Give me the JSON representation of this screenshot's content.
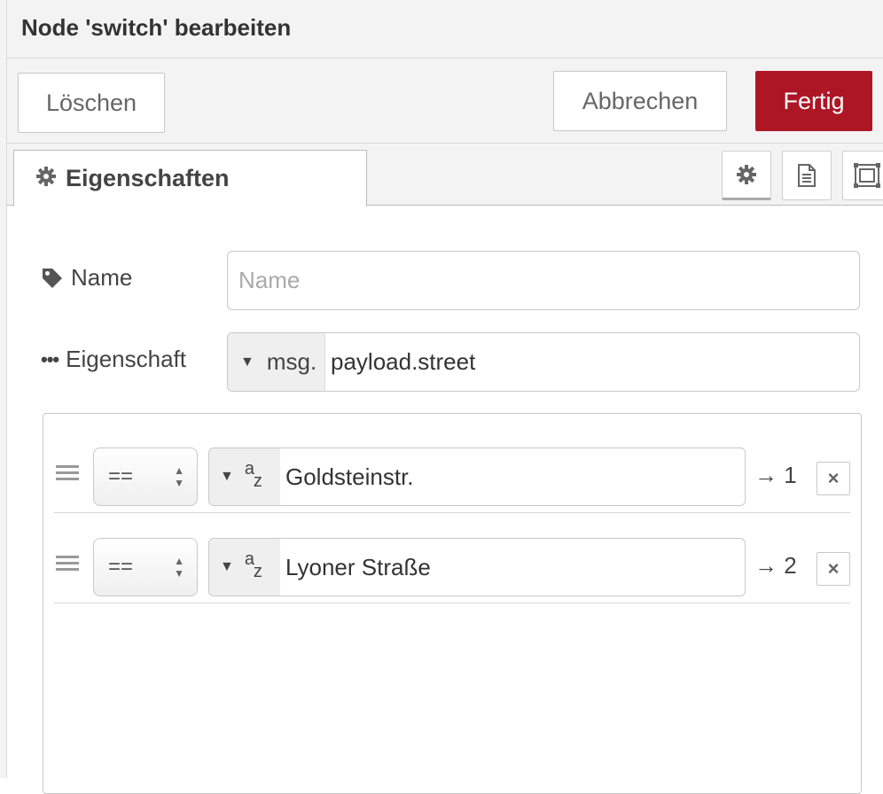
{
  "header": {
    "title": "Node 'switch' bearbeiten"
  },
  "toolbar": {
    "delete_label": "Löschen",
    "cancel_label": "Abbrechen",
    "done_label": "Fertig"
  },
  "tabs": {
    "properties_label": "Eigenschaften",
    "icons": [
      "gear-icon",
      "document-icon",
      "frame-icon"
    ]
  },
  "form": {
    "name_label": "Name",
    "name_placeholder": "Name",
    "property_label": "Eigenschaft",
    "property_type": "msg.",
    "property_value": "payload.street"
  },
  "rules": [
    {
      "operator": "==",
      "value": "Goldsteinstr.",
      "output": "→ 1"
    },
    {
      "operator": "==",
      "value": "Lyoner Straße",
      "output": "→ 2"
    }
  ],
  "colors": {
    "primary": "#ad1625",
    "panel": "#f3f3f3",
    "border": "#c8c8c8"
  }
}
